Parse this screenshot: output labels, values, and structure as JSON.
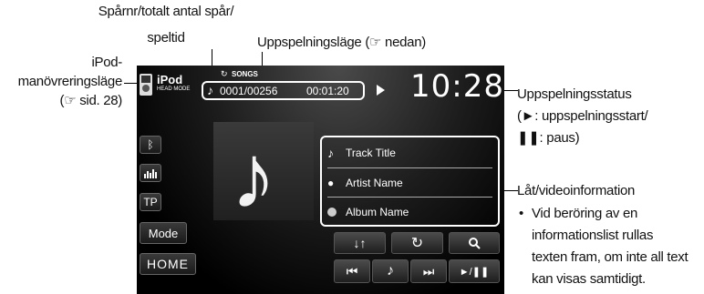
{
  "callouts": {
    "track_num_line1": "Spårnr/totalt antal spår/",
    "track_num_line2": "speltid",
    "play_mode": "Uppspelningsläge (☞ nedan)",
    "ipod_mode_line1": "iPod-",
    "ipod_mode_line2": "manövreringsläge",
    "ipod_mode_line3": "(☞ sid. 28)",
    "play_status_line1": "Uppspelningsstatus",
    "play_status_line2": "(►: uppspelningsstart/",
    "play_status_line3": "❚❚: paus)",
    "song_info_title": "Låt/videoinformation",
    "song_info_bullet": "•",
    "song_info_line1": "Vid beröring av en",
    "song_info_line2": "informationslist rullas",
    "song_info_line3": "texten fram, om inte all text",
    "song_info_line4": "kan visas samtidigt."
  },
  "screen": {
    "source_name": "iPod",
    "source_sub": "HEAD MODE",
    "repeat_mode": "SONGS",
    "track_counter": "0001/00256",
    "play_time": "00:01:20",
    "clock": "10:28",
    "info": {
      "track_title": "Track Title",
      "artist_name": "Artist Name",
      "album_name": "Album Name"
    },
    "side_buttons": {
      "bluetooth_icon": "bluetooth-icon",
      "eq_icon": "equalizer-icon",
      "tp": "TP",
      "mode": "Mode",
      "home": "HOME"
    },
    "controls": {
      "shuffle_icon": "↓↑",
      "repeat_icon": "↻",
      "search_icon": "search-icon",
      "prev_icon": "⏮",
      "note_icon": "♪",
      "next_icon": "⏭",
      "playpause_icon": "►/❚❚"
    }
  }
}
